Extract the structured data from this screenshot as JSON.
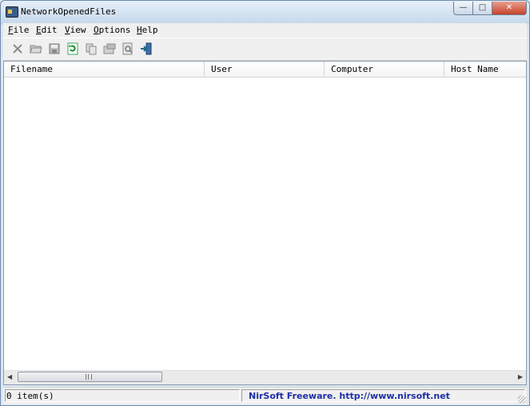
{
  "window": {
    "title": "NetworkOpenedFiles"
  },
  "menu": {
    "items": [
      {
        "accel": "F",
        "rest": "ile"
      },
      {
        "accel": "E",
        "rest": "dit"
      },
      {
        "accel": "V",
        "rest": "iew"
      },
      {
        "accel": "O",
        "rest": "ptions"
      },
      {
        "accel": "H",
        "rest": "elp"
      }
    ]
  },
  "toolbar": {
    "icons": [
      "close-files-icon",
      "open-folder-icon",
      "save-icon",
      "refresh-icon",
      "copy-icon",
      "properties-icon",
      "find-icon",
      "exit-icon"
    ]
  },
  "list": {
    "columns": [
      "Filename",
      "User",
      "Computer",
      "Host Name"
    ],
    "rows": []
  },
  "status": {
    "count": "0 item(s)",
    "credit": "NirSoft Freeware.  http://www.nirsoft.net"
  }
}
